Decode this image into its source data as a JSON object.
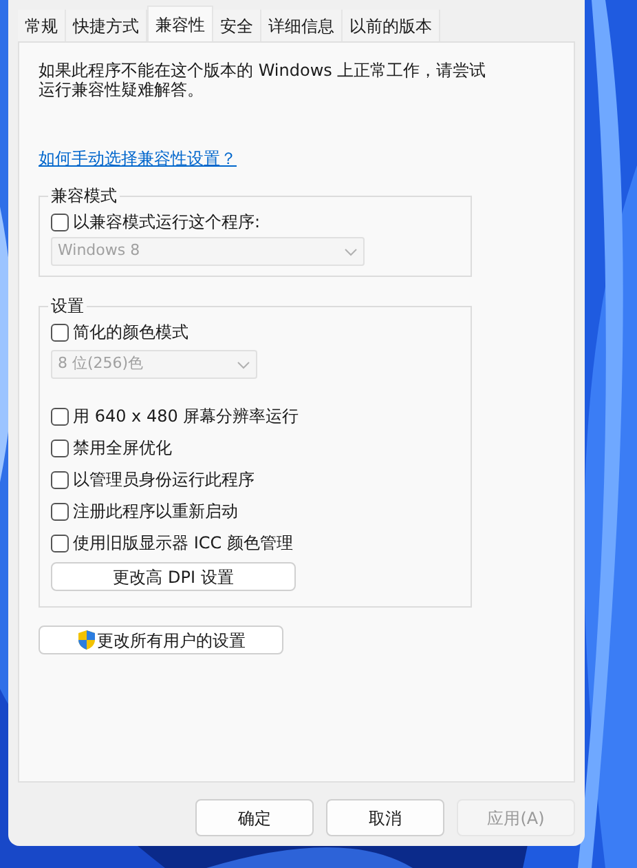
{
  "tabs": [
    {
      "label": "常规",
      "selected": false
    },
    {
      "label": "快捷方式",
      "selected": false
    },
    {
      "label": "兼容性",
      "selected": true
    },
    {
      "label": "安全",
      "selected": false
    },
    {
      "label": "详细信息",
      "selected": false
    },
    {
      "label": "以前的版本",
      "selected": false
    }
  ],
  "intro": "如果此程序不能在这个版本的 Windows 上正常工作，请尝试运行兼容性疑难解答。",
  "help_link": "如何手动选择兼容性设置？",
  "compat_group": {
    "title": "兼容模式",
    "checkbox": {
      "label": "以兼容模式运行这个程序:",
      "checked": false
    },
    "dropdown": {
      "value": "Windows 8",
      "disabled": true
    }
  },
  "settings_group": {
    "title": "设置",
    "items": [
      {
        "kind": "checkbox",
        "label": "简化的颜色模式",
        "checked": false
      },
      {
        "kind": "dropdown",
        "value": "8 位(256)色",
        "disabled": true
      },
      {
        "kind": "checkbox",
        "label": "用 640 x 480 屏幕分辨率运行",
        "checked": false
      },
      {
        "kind": "checkbox",
        "label": "禁用全屏优化",
        "checked": false
      },
      {
        "kind": "checkbox",
        "label": "以管理员身份运行此程序",
        "checked": false
      },
      {
        "kind": "checkbox",
        "label": "注册此程序以重新启动",
        "checked": false
      },
      {
        "kind": "checkbox",
        "label": "使用旧版显示器 ICC 颜色管理",
        "checked": false
      },
      {
        "kind": "button",
        "label": "更改高 DPI 设置"
      }
    ]
  },
  "all_users_button": "更改所有用户的设置",
  "buttons": [
    {
      "label": "确定",
      "disabled": false
    },
    {
      "label": "取消",
      "disabled": false
    },
    {
      "label": "应用(A)",
      "disabled": true
    }
  ]
}
